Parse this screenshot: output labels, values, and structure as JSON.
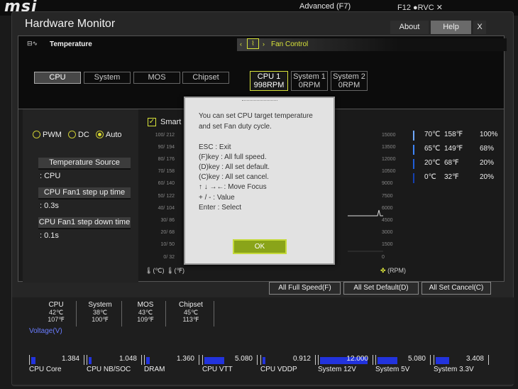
{
  "background": {
    "logo": "msi",
    "advanced_label": "Advanced (F7)",
    "top_right_label": "F12   ●RVC  ✕"
  },
  "window": {
    "title": "Hardware Monitor",
    "about": "About",
    "help": "Help",
    "close": "X"
  },
  "temperature": {
    "title": "Temperature",
    "tabs": [
      "CPU",
      "System",
      "MOS",
      "Chipset"
    ],
    "active_tab": "CPU"
  },
  "fan_control": {
    "title": "Fan Control",
    "tabs": [
      {
        "name": "CPU 1",
        "value": "998RPM"
      },
      {
        "name": "System 1",
        "value": "0RPM"
      },
      {
        "name": "System 2",
        "value": "0RPM"
      }
    ],
    "active_tab": "CPU 1"
  },
  "mode": {
    "options": [
      "PWM",
      "DC",
      "Auto"
    ],
    "selected": "Auto"
  },
  "settings": {
    "temp_source_label": "Temperature Source",
    "temp_source_value": ": CPU",
    "step_up_label": "CPU Fan1 step up time",
    "step_up_value": ": 0.3s",
    "step_down_label": "CPU Fan1 step down time",
    "step_down_value": ": 0.1s"
  },
  "chart": {
    "smart_label": "Smart F",
    "left_ticks": [
      "100/ 212",
      "90/ 194",
      "80/ 176",
      "70/ 158",
      "60/ 140",
      "50/ 122",
      "40/ 104",
      "30/ 86",
      "20/ 68",
      "10/ 50",
      "0/ 32"
    ],
    "right_ticks": [
      "15000",
      "13500",
      "12000",
      "10500",
      "9000",
      "7500",
      "6000",
      "4500",
      "3000",
      "1500",
      "0"
    ],
    "unit_c": "(℃)",
    "unit_f": "(℉)",
    "unit_rpm": "(RPM)"
  },
  "thresholds": [
    {
      "c": "70℃",
      "f": "158℉",
      "p": "100%"
    },
    {
      "c": "65℃",
      "f": "149℉",
      "p": "68%"
    },
    {
      "c": "20℃",
      "f": "68℉",
      "p": "20%"
    },
    {
      "c": "0℃",
      "f": "32℉",
      "p": "20%"
    }
  ],
  "actions": {
    "full_speed": "All Full Speed(F)",
    "set_default": "All Set Default(D)",
    "set_cancel": "All Set Cancel(C)"
  },
  "stats": [
    {
      "name": "CPU",
      "c": "42℃",
      "f": "107℉"
    },
    {
      "name": "System",
      "c": "38℃",
      "f": "100℉"
    },
    {
      "name": "MOS",
      "c": "43℃",
      "f": "109℉"
    },
    {
      "name": "Chipset",
      "c": "45℃",
      "f": "113℉"
    }
  ],
  "voltage": {
    "title": "Voltage(V)",
    "items": [
      {
        "label": "CPU Core",
        "value": "1.384",
        "fill": 0.08
      },
      {
        "label": "CPU NB/SOC",
        "value": "1.048",
        "fill": 0.05
      },
      {
        "label": "DRAM",
        "value": "1.360",
        "fill": 0.07
      },
      {
        "label": "CPU VTT",
        "value": "5.080",
        "fill": 0.38
      },
      {
        "label": "CPU VDDP",
        "value": "0.912",
        "fill": 0.05
      },
      {
        "label": "System 12V",
        "value": "12.000",
        "fill": 0.9
      },
      {
        "label": "System 5V",
        "value": "5.080",
        "fill": 0.38
      },
      {
        "label": "System 3.3V",
        "value": "3.408",
        "fill": 0.25
      }
    ]
  },
  "dialog": {
    "lines": [
      "You can set CPU target temperature",
      "and set Fan duty cycle.",
      "",
      "ESC      : Exit",
      "(F)key : All full speed.",
      "(D)key : All set default.",
      "(C)key : All set cancel.",
      "↑ ↓ →←: Move Focus",
      "+ / -     : Value",
      "Enter  : Select"
    ],
    "ok": "OK"
  },
  "colors": {
    "accent": "#d8e33a",
    "bar_blue": "#2233dd",
    "voltage_title": "#6a7dff"
  }
}
